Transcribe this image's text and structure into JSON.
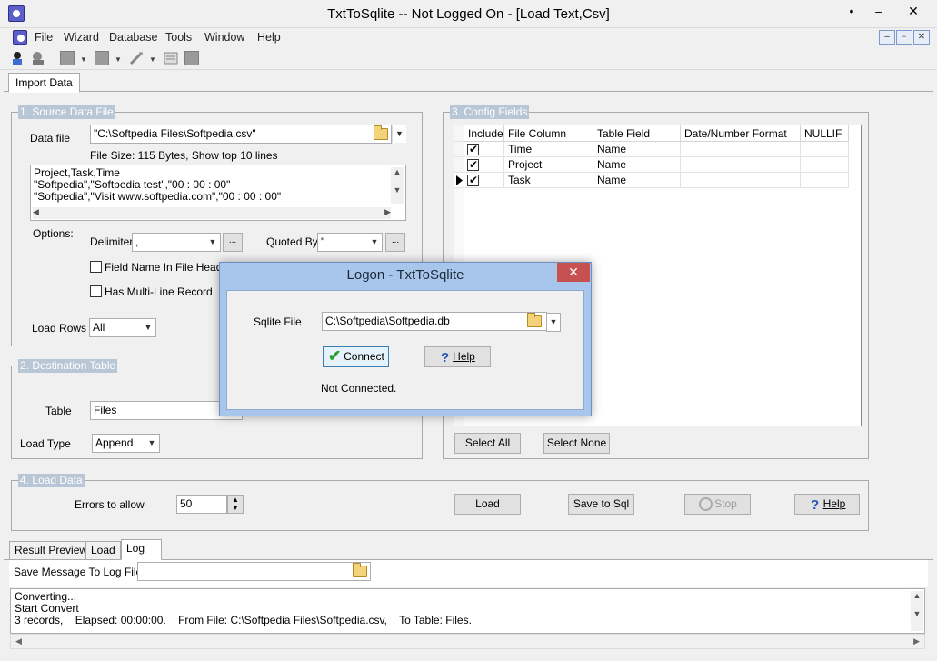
{
  "window": {
    "title": "TxtToSqlite -- Not Logged On - [Load Text,Csv]",
    "buttons": [
      "•",
      "–",
      "✕"
    ]
  },
  "menu": [
    "File",
    "Wizard",
    "Database",
    "Tools",
    "Window",
    "Help"
  ],
  "mdi_buttons": [
    "–",
    "▫",
    "✕"
  ],
  "tabs": {
    "active": "Import Data"
  },
  "source": {
    "legend": "1. Source Data File",
    "data_file_label": "Data file",
    "data_file_value": "\"C:\\Softpedia Files\\Softpedia.csv\"",
    "file_info": "File Size: 115 Bytes,  Show top 10 lines",
    "preview_lines": "Project,Task,Time\n\"Softpedia\",\"Softpedia test\",\"00 : 00 : 00\"\n\"Softpedia\",\"Visit www.softpedia.com\",\"00 : 00 : 00\"",
    "options_label": "Options:",
    "delimiter_label": "Delimiter",
    "delimiter_value": ",",
    "quoted_by_label": "Quoted By",
    "quoted_by_value": "\"",
    "ellipsis": "...",
    "field_name_header": "Field Name In File Header",
    "multiline": "Has Multi-Line Record",
    "load_rows_label": "Load Rows",
    "load_rows_value": "All"
  },
  "destination": {
    "legend": "2. Destination Table",
    "table_label": "Table",
    "table_value": "Files",
    "load_type_label": "Load Type",
    "load_type_value": "Append"
  },
  "config": {
    "legend": "3. Config Fields",
    "columns": [
      "Include",
      "File Column",
      "Table Field",
      "Date/Number Format",
      "NULLIF"
    ],
    "rows": [
      {
        "include": true,
        "file_column": "Time",
        "table_field": "Name"
      },
      {
        "include": true,
        "file_column": "Project",
        "table_field": "Name"
      },
      {
        "include": true,
        "file_column": "Task",
        "table_field": "Name"
      }
    ],
    "select_all": "Select All",
    "select_none": "Select None"
  },
  "load": {
    "legend": "4. Load Data",
    "errors_label": "Errors to allow",
    "errors_value": "50",
    "load_btn": "Load",
    "save_btn": "Save to Sql",
    "stop_btn": "Stop",
    "help_btn": "Help"
  },
  "bottom_tabs": [
    "Result Preview",
    "Load",
    "Log"
  ],
  "log": {
    "save_label": "Save Message To Log File",
    "text": "Converting...\nStart Convert\n3 records,    Elapsed: 00:00:00.    From File: C:\\Softpedia Files\\Softpedia.csv,    To Table: Files."
  },
  "dialog": {
    "title": "Logon - TxtToSqlite",
    "close": "✕",
    "sqlite_label": "Sqlite File",
    "sqlite_value": "C:\\Softpedia\\Softpedia.db",
    "connect_btn": "Connect",
    "help_btn": "Help",
    "status": "Not Connected."
  },
  "colors": {
    "legend_bg": "#b9c6d6",
    "dialog_frame": "#a8c6ec",
    "close_red": "#c75050"
  }
}
